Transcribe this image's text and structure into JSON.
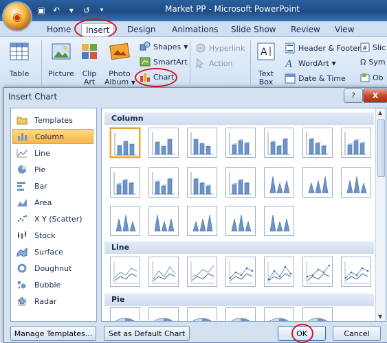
{
  "window": {
    "title": "Market PP - Microsoft PowerPoint"
  },
  "ribbon_tabs": [
    "Home",
    "Insert",
    "Design",
    "Animations",
    "Slide Show",
    "Review",
    "View"
  ],
  "ribbon": {
    "table": "Table",
    "picture": "Picture",
    "clip_art": [
      "Clip",
      "Art"
    ],
    "photo_album": [
      "Photo",
      "Album"
    ],
    "shapes": "Shapes",
    "smartart": "SmartArt",
    "chart": "Chart",
    "hyperlink": "Hyperlink",
    "action": "Action",
    "text_box": [
      "Text",
      "Box"
    ],
    "header_footer": "Header & Footer",
    "wordart": "WordArt",
    "date_time": "Date & Time",
    "slide_number": "Slic",
    "symbol": "Sym",
    "object": "Ob"
  },
  "dialog": {
    "title": "Insert Chart",
    "help": "?",
    "close": "X",
    "chart_types": [
      {
        "label": "Templates",
        "icon": "folder-icon"
      },
      {
        "label": "Column",
        "icon": "column-chart-icon",
        "selected": true
      },
      {
        "label": "Line",
        "icon": "line-chart-icon"
      },
      {
        "label": "Pie",
        "icon": "pie-chart-icon"
      },
      {
        "label": "Bar",
        "icon": "bar-chart-icon"
      },
      {
        "label": "Area",
        "icon": "area-chart-icon"
      },
      {
        "label": "X Y (Scatter)",
        "icon": "scatter-chart-icon"
      },
      {
        "label": "Stock",
        "icon": "stock-chart-icon"
      },
      {
        "label": "Surface",
        "icon": "surface-chart-icon"
      },
      {
        "label": "Doughnut",
        "icon": "doughnut-chart-icon"
      },
      {
        "label": "Bubble",
        "icon": "bubble-chart-icon"
      },
      {
        "label": "Radar",
        "icon": "radar-chart-icon"
      }
    ],
    "gallery_sections": [
      "Column",
      "Line",
      "Pie"
    ],
    "buttons": {
      "manage_templates": "Manage Templates...",
      "set_default": "Set as Default Chart",
      "ok": "OK",
      "cancel": "Cancel"
    }
  },
  "colors": {
    "accent": "#f6b54b",
    "highlight_ring": "#d7141a",
    "chart_blue": "#6f94c7"
  }
}
